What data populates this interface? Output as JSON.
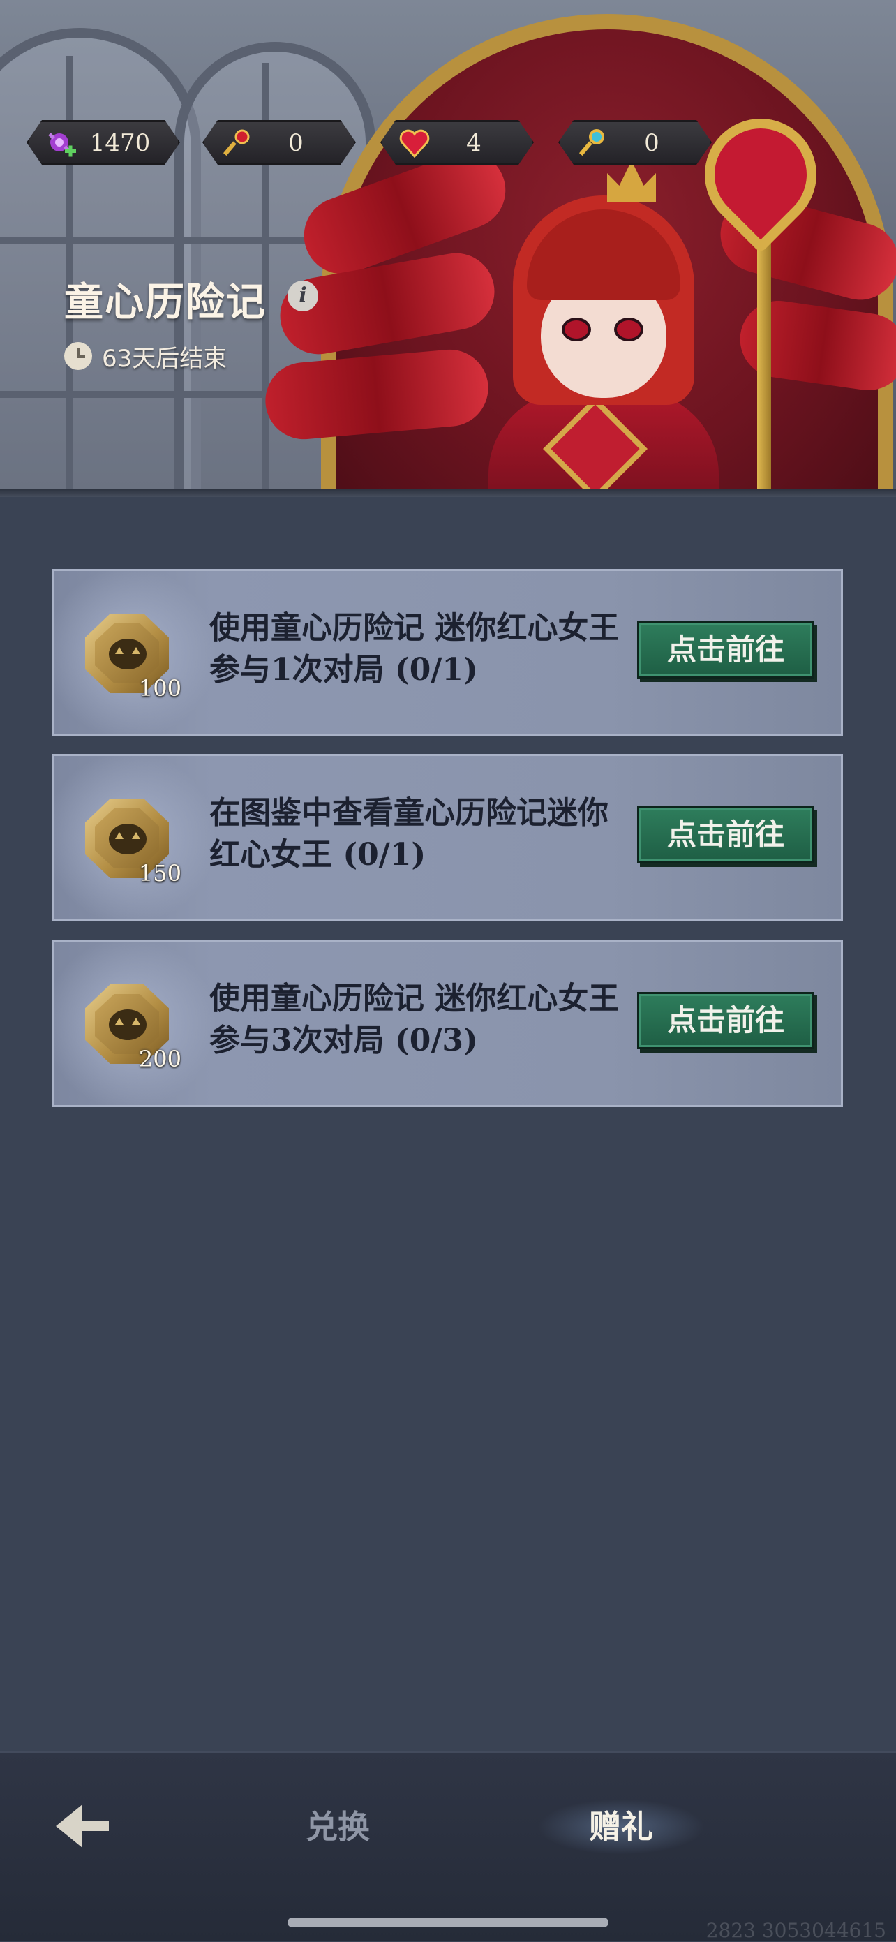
{
  "currencies": [
    {
      "icon": "candy-plus-icon",
      "value": "1470"
    },
    {
      "icon": "red-key-icon",
      "value": "0"
    },
    {
      "icon": "heart-icon",
      "value": "4"
    },
    {
      "icon": "gold-key-icon",
      "value": "0"
    }
  ],
  "event": {
    "title": "童心历险记",
    "info_glyph": "i",
    "countdown": "63天后结束"
  },
  "tasks": [
    {
      "reward": "100",
      "description": "使用童心历险记 迷你红心女王参与1次对局 (0/1)",
      "button": "点击前往"
    },
    {
      "reward": "150",
      "description": "在图鉴中查看童心历险记迷你红心女王 (0/1)",
      "button": "点击前往"
    },
    {
      "reward": "200",
      "description": "使用童心历险记 迷你红心女王参与3次对局 (0/3)",
      "button": "点击前往"
    }
  ],
  "nav": {
    "exchange": "兑换",
    "gift": "赠礼"
  },
  "watermark": "2823 3053044615",
  "colors": {
    "accent_button": "#2e7d5c",
    "card_bg": "#8a94ac",
    "page_bg": "#3a4354"
  }
}
